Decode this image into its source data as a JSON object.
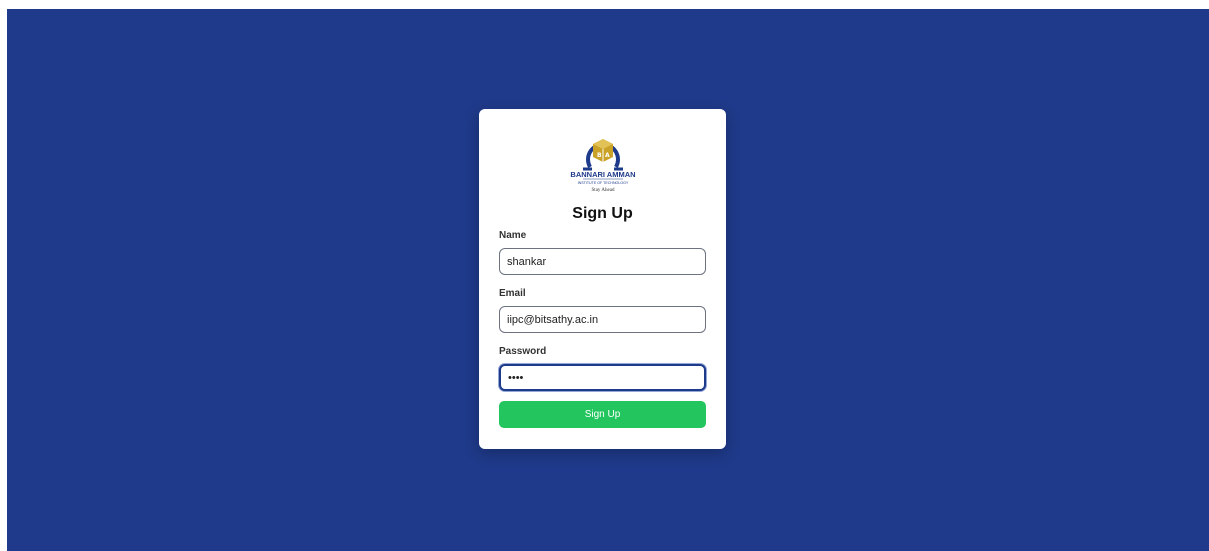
{
  "logo": {
    "name_line": "BANNARI AMMAN",
    "sub_line": "INSTITUTE OF TECHNOLOGY",
    "tagline": "Stay Ahead",
    "colors": {
      "blue": "#1e3a8a",
      "gold": "#c9a227"
    }
  },
  "form": {
    "title": "Sign Up",
    "name_label": "Name",
    "name_value": "shankar",
    "email_label": "Email",
    "email_value": "iipc@bitsathy.ac.in",
    "password_label": "Password",
    "password_value": "1234",
    "submit_label": "Sign Up"
  },
  "colors": {
    "background": "#1f3a8a",
    "card": "#ffffff",
    "button": "#22c55e"
  }
}
